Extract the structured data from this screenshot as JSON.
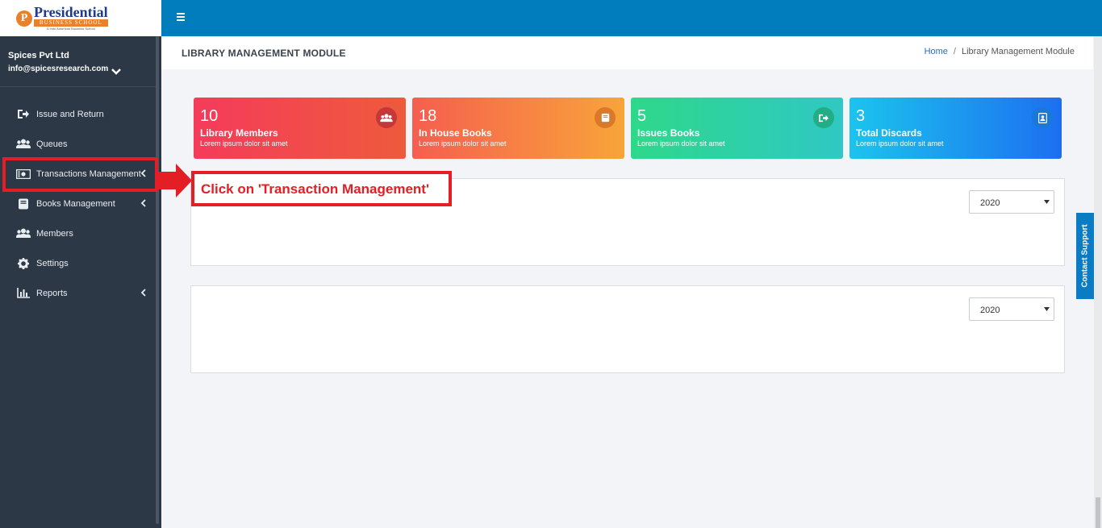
{
  "logo": {
    "letter": "P",
    "name": "Presidential",
    "sub": "BUSINESS SCHOOL",
    "tag": "A Indo American Business School"
  },
  "user": {
    "name": "Spices Pvt Ltd",
    "email": "info@spicesresearch.com"
  },
  "nav": [
    {
      "label": "Issue and Return",
      "icon": "sign-out-icon",
      "has_arrow": false
    },
    {
      "label": "Queues",
      "icon": "users-icon",
      "has_arrow": false
    },
    {
      "label": "Transactions Management",
      "icon": "money-icon",
      "has_arrow": true,
      "highlighted": true
    },
    {
      "label": "Books Management",
      "icon": "book-icon",
      "has_arrow": true
    },
    {
      "label": "Members",
      "icon": "users-icon",
      "has_arrow": false
    },
    {
      "label": "Settings",
      "icon": "gear-icon",
      "has_arrow": false
    },
    {
      "label": "Reports",
      "icon": "bar-chart-icon",
      "has_arrow": true
    }
  ],
  "header": {
    "title": "LIBRARY MANAGEMENT MODULE",
    "breadcrumb_home": "Home",
    "breadcrumb_separator": "/",
    "breadcrumb_current": "Library Management Module"
  },
  "cards": [
    {
      "value": "10",
      "title": "Library Members",
      "sub": "Lorem ipsum dolor sit amet",
      "icon": "users-icon"
    },
    {
      "value": "18",
      "title": "In House Books",
      "sub": "Lorem ipsum dolor sit amet",
      "icon": "book-icon"
    },
    {
      "value": "5",
      "title": "Issues Books",
      "sub": "Lorem ipsum dolor sit amet",
      "icon": "sign-out-icon"
    },
    {
      "value": "3",
      "title": "Total Discards",
      "sub": "Lorem ipsum dolor sit amet",
      "icon": "address-book-icon"
    }
  ],
  "panels": [
    {
      "year": "2020"
    },
    {
      "year": "2020"
    }
  ],
  "annotation": {
    "text": "Click on 'Transaction Management'",
    "color": "#e31e24"
  },
  "contact_support": "Contact Support",
  "colors": {
    "topbar": "#017cbd",
    "sidebar": "#2c3846",
    "accent": "#e31e24"
  }
}
